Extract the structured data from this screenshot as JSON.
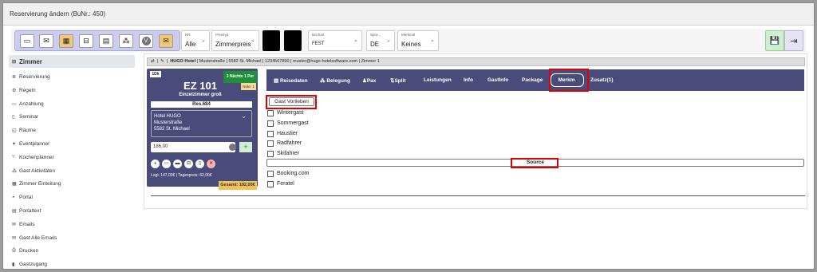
{
  "window": {
    "title": "Reservierung ändern (BuNr.: 450)"
  },
  "toolbar": {
    "icons": [
      "id-card-icon",
      "envelope-icon",
      "calculator-icon",
      "bed-icon",
      "grid-icon",
      "people-icon",
      "circle-v-icon",
      "open-envelope-icon"
    ],
    "nr": {
      "label": "NR.",
      "value": "Alle"
    },
    "preistyp": {
      "label": "Preistyp",
      "value": "Zimmerpreis"
    },
    "buchart": {
      "label": "Buchart",
      "value": "FEST"
    },
    "sprache": {
      "label": "Spra...",
      "value": "DE"
    },
    "merkmal": {
      "label": "Merkmal",
      "value": "Keines"
    }
  },
  "sidebar": {
    "items": [
      {
        "label": "Zimmer",
        "icon": "bed-icon"
      },
      {
        "label": "Reservierung",
        "icon": "list-icon"
      },
      {
        "label": "Regeln",
        "icon": "rules-icon"
      },
      {
        "label": "Anzahlung",
        "icon": "money-icon"
      },
      {
        "label": "Seminar",
        "icon": "seminar-icon"
      },
      {
        "label": "Räume",
        "icon": "room-icon"
      },
      {
        "label": "Eventplanner",
        "icon": "event-icon"
      },
      {
        "label": "Küchenplanner",
        "icon": "cutlery-icon"
      },
      {
        "label": "Gast Aktivitäten",
        "icon": "activity-icon"
      },
      {
        "label": "Zimmer Einteilung",
        "icon": "layout-icon"
      },
      {
        "label": "Portal",
        "icon": "portal-icon"
      },
      {
        "label": "Portaltext",
        "icon": "text-icon"
      },
      {
        "label": "Emails",
        "icon": "email-icon"
      },
      {
        "label": "Gast Alle Emails",
        "icon": "emails-icon"
      },
      {
        "label": "Drucken",
        "icon": "print-icon"
      },
      {
        "label": "Gastzugang",
        "icon": "lock-icon"
      }
    ]
  },
  "infobar": {
    "hotel": "HUGO Hotel",
    "address": "| Musterstraße | 5582 St. Michael | 1234567890 | muster@hugo-hotelsoftware.com | Zimmer 1"
  },
  "room": {
    "badge": "1Dk",
    "name": "EZ 101",
    "type": "Einzelzimmer groß",
    "nights_badge": "3 Nächte 1 Per",
    "note": "Note: 1",
    "res": "Res.684",
    "hotel_lines": [
      "Hotel HUGO",
      "Musterstraße",
      "5582 St. Michael"
    ],
    "price": "186,00",
    "logis": "Logi: 147,00€ | Tagespreis: 62,00€",
    "total": "Gesamt: 192,00€"
  },
  "tabs": [
    "Reisedaten",
    "Belegung",
    "Pax",
    "Split",
    "Leistungen",
    "Info",
    "GastInfo",
    "Package",
    "Merkm.",
    "Zusatz(1)"
  ],
  "merkmale": {
    "header_button": "Gast Vorlieben",
    "items": [
      "Wintergast",
      "Sommergast",
      "Haustier",
      "Radfahrer",
      "Skifahrer"
    ],
    "source_label": "Source",
    "source_items": [
      "Booking.com",
      "Feratel"
    ]
  }
}
